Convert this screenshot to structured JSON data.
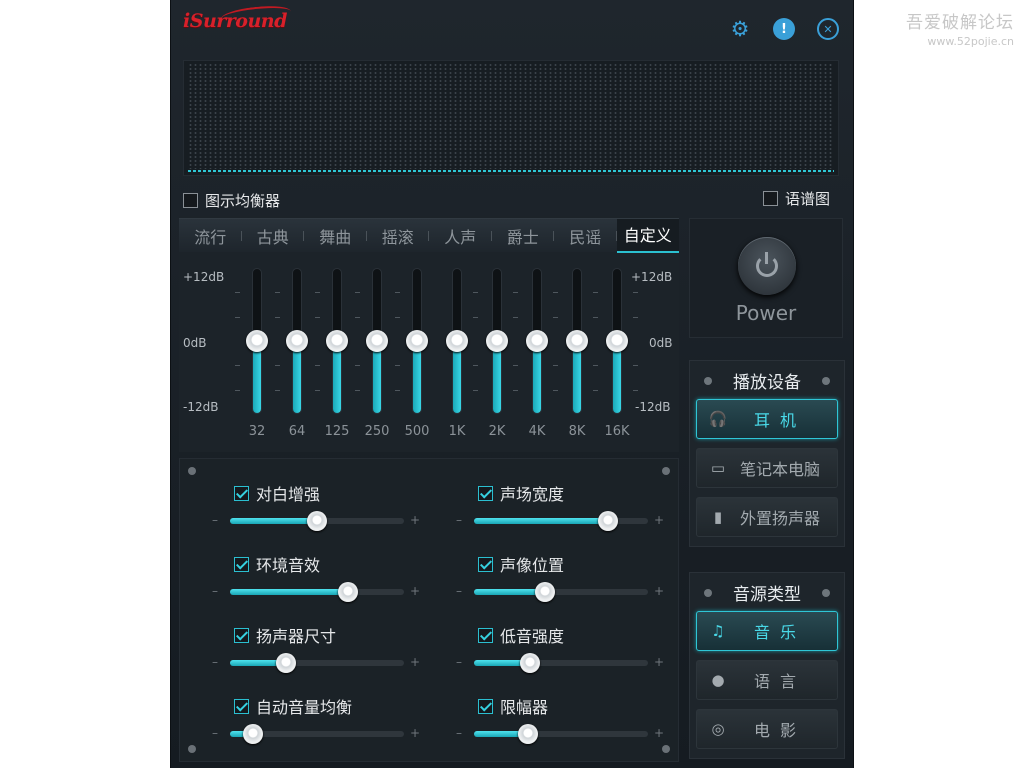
{
  "watermark": {
    "title": "吾爱破解论坛",
    "url": "www.52pojie.cn"
  },
  "app": {
    "logo": "iSurround"
  },
  "toggles": {
    "graphic_eq": "图示均衡器",
    "spectrum": "语谱图"
  },
  "eq": {
    "presets": [
      "流行",
      "古典",
      "舞曲",
      "摇滚",
      "人声",
      "爵士",
      "民谣",
      "自定义"
    ],
    "active_preset": "自定义",
    "db_max": "+12dB",
    "db_zero": "0dB",
    "db_min": "-12dB",
    "bands": [
      {
        "freq": "32",
        "gain_db": 0
      },
      {
        "freq": "64",
        "gain_db": 0
      },
      {
        "freq": "125",
        "gain_db": 0
      },
      {
        "freq": "250",
        "gain_db": 0
      },
      {
        "freq": "500",
        "gain_db": 0
      },
      {
        "freq": "1K",
        "gain_db": 0
      },
      {
        "freq": "2K",
        "gain_db": 0
      },
      {
        "freq": "4K",
        "gain_db": 0
      },
      {
        "freq": "8K",
        "gain_db": 0
      },
      {
        "freq": "16K",
        "gain_db": 0
      }
    ]
  },
  "power": {
    "label": "Power"
  },
  "effects": {
    "minus": "–",
    "plus": "+",
    "items": [
      {
        "label": "对白增强",
        "checked": true,
        "level": 0.5
      },
      {
        "label": "声场宽度",
        "checked": true,
        "level": 0.77
      },
      {
        "label": "环境音效",
        "checked": true,
        "level": 0.68
      },
      {
        "label": "声像位置",
        "checked": true,
        "level": 0.41
      },
      {
        "label": "扬声器尺寸",
        "checked": true,
        "level": 0.32
      },
      {
        "label": "低音强度",
        "checked": true,
        "level": 0.32
      },
      {
        "label": "自动音量均衡",
        "checked": true,
        "level": 0.13
      },
      {
        "label": "限幅器",
        "checked": true,
        "level": 0.31
      }
    ]
  },
  "playback_device": {
    "title": "播放设备",
    "options": [
      {
        "label": "耳机",
        "icon": "headphones-icon",
        "active": true
      },
      {
        "label": "笔记本电脑",
        "icon": "laptop-icon",
        "active": false
      },
      {
        "label": "外置扬声器",
        "icon": "speaker-icon",
        "active": false
      }
    ]
  },
  "source_type": {
    "title": "音源类型",
    "options": [
      {
        "label": "音乐",
        "icon": "music-note-icon",
        "active": true
      },
      {
        "label": "语言",
        "icon": "speech-icon",
        "active": false
      },
      {
        "label": "电影",
        "icon": "film-reel-icon",
        "active": false
      }
    ]
  },
  "colors": {
    "accent": "#2bc0d0",
    "background": "#1b2227"
  }
}
